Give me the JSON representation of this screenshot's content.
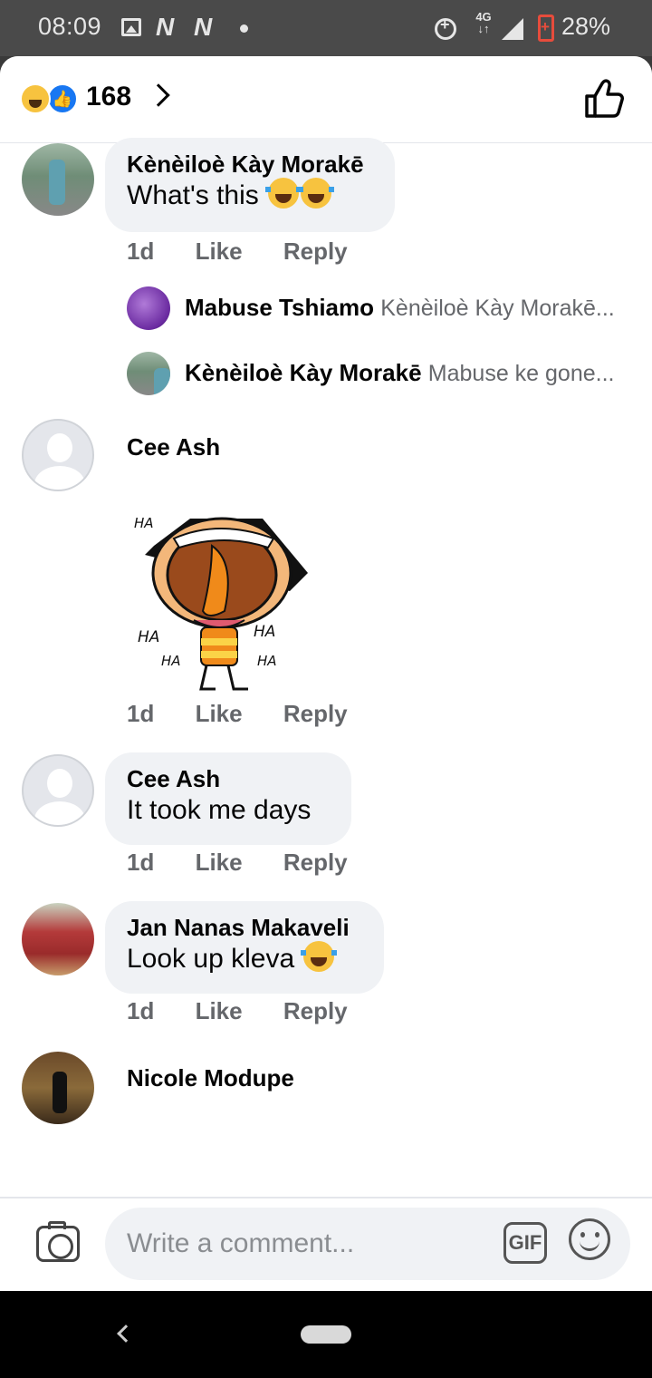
{
  "status_bar": {
    "time": "08:09",
    "network": "4G",
    "battery_pct": "28%",
    "icons": [
      "gallery-icon",
      "n-icon",
      "n-icon",
      "dot-icon",
      "rotate-icon",
      "signal-icon",
      "battery-icon"
    ]
  },
  "header": {
    "reaction_count": "168",
    "reactions": [
      "haha-reaction-icon",
      "like-reaction-icon"
    ]
  },
  "comments": [
    {
      "author": "Kènèiloè Kày Morakē",
      "text": "What's this",
      "emoji": [
        "tears-of-joy",
        "tears-of-joy"
      ],
      "time": "1d",
      "like": "Like",
      "reply": "Reply",
      "replies": [
        {
          "author": "Mabuse Tshiamo",
          "preview": "Kènèiloè Kày Morakē..."
        },
        {
          "author": "Kènèiloè Kày Morakē",
          "preview": "Mabuse ke gone..."
        }
      ]
    },
    {
      "author": "Cee Ash",
      "sticker": "laughing-ha-ha-sticker",
      "sticker_text": "HA",
      "time": "1d",
      "like": "Like",
      "reply": "Reply"
    },
    {
      "author": "Cee Ash",
      "text": "It took me days",
      "time": "1d",
      "like": "Like",
      "reply": "Reply"
    },
    {
      "author": "Jan Nanas Makaveli",
      "text": "Look up kleva",
      "emoji": [
        "rolling-laughing"
      ],
      "time": "1d",
      "like": "Like",
      "reply": "Reply"
    },
    {
      "author": "Nicole Modupe"
    }
  ],
  "composer": {
    "placeholder": "Write a comment...",
    "gif_label": "GIF"
  },
  "colors": {
    "like_blue": "#1877f2",
    "bubble_bg": "#f0f2f5",
    "meta_gray": "#65676b"
  }
}
